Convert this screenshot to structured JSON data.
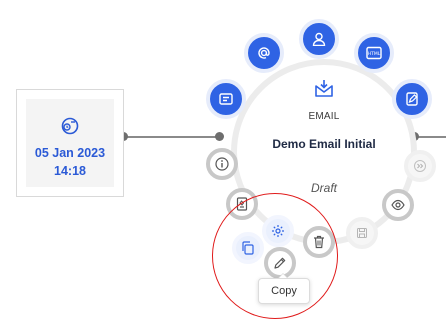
{
  "date_node": {
    "date": "05 Jan 2023",
    "time": "14:18",
    "icon": "calendar-clock-icon"
  },
  "email_node": {
    "type_label": "EMAIL",
    "title": "Demo Email Initial",
    "status": "Draft",
    "type_icon": "mail-download-icon"
  },
  "actions": {
    "top": [
      "list-icon",
      "at-sign-icon",
      "user-icon",
      "html-icon",
      "edit-document-icon"
    ],
    "side": [
      "info-icon",
      "preview-icon",
      "fast-forward-icon",
      "save-icon",
      "document-icon",
      "settings-icon",
      "delete-icon",
      "copy-icon",
      "edit-pencil-icon"
    ]
  },
  "tooltip": {
    "label": "Copy"
  },
  "colors": {
    "primary_blue": "#2f63e4",
    "highlight_ring": "#e01b1b",
    "date_text": "#2b5ad6"
  }
}
